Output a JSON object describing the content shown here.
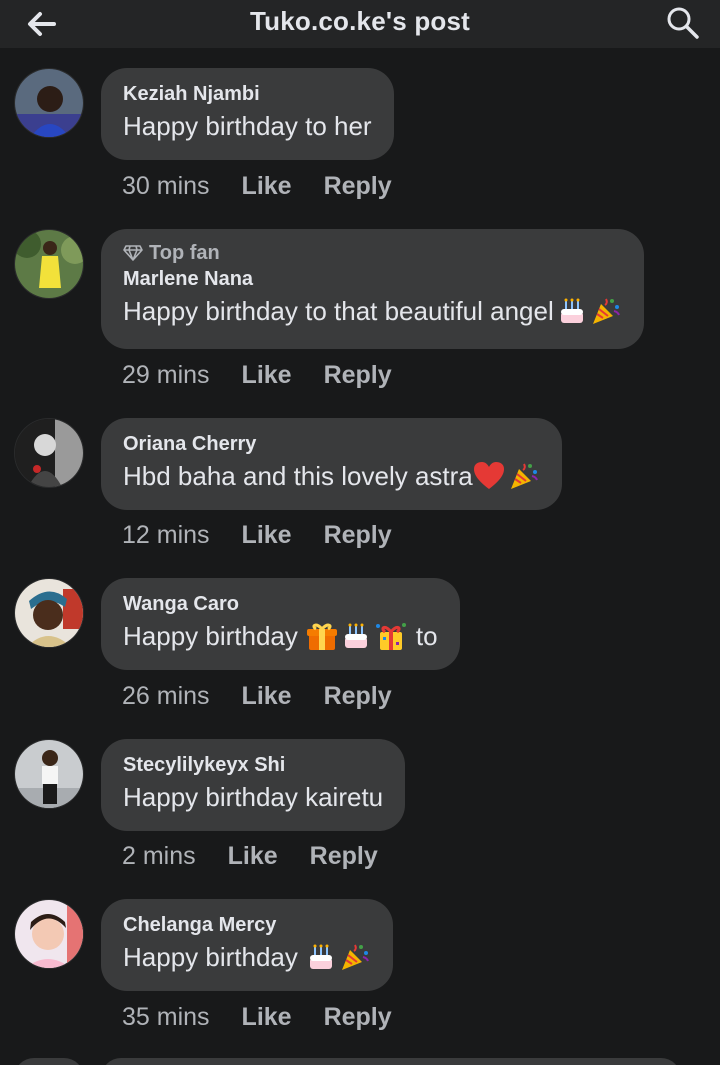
{
  "header": {
    "title": "Tuko.co.ke's post",
    "back_icon": "arrow-left-icon",
    "search_icon": "search-icon"
  },
  "actions": {
    "like": "Like",
    "reply": "Reply"
  },
  "colors": {
    "background": "#18191a",
    "bubble": "#3a3b3c",
    "secondary_text": "#b0b3b8",
    "primary_text": "#e4e6eb"
  },
  "comments": [
    {
      "author": "Keziah Njambi",
      "text": "Happy birthday  to her",
      "time": "30 mins",
      "emojis": [],
      "after": ""
    },
    {
      "badge": "Top fan",
      "author": "Marlene Nana",
      "text": "Happy birthday to that beautiful angel",
      "time": "29 mins",
      "emojis": [
        "birthday-cake-emoji",
        "party-popper-emoji"
      ],
      "after": ""
    },
    {
      "author": "Oriana Cherry",
      "text": "Hbd baha and this lovely astra",
      "time": "12 mins",
      "emojis": [
        "red-heart-emoji",
        "party-popper-emoji"
      ],
      "after": ""
    },
    {
      "author": "Wanga Caro",
      "text": "Happy birthday",
      "time": "26 mins",
      "emojis": [
        "wrapped-gift-emoji",
        "birthday-cake-emoji",
        "gift-confetti-emoji"
      ],
      "after": "to"
    },
    {
      "author": "Stecylilykeyx Shi",
      "text": "Happy birthday kairetu",
      "time": "2 mins",
      "emojis": [],
      "after": ""
    },
    {
      "author": "Chelanga Mercy",
      "text": "Happy birthday",
      "time": "35 mins",
      "emojis": [
        "birthday-cake-emoji",
        "party-popper-emoji"
      ],
      "after": ""
    }
  ]
}
